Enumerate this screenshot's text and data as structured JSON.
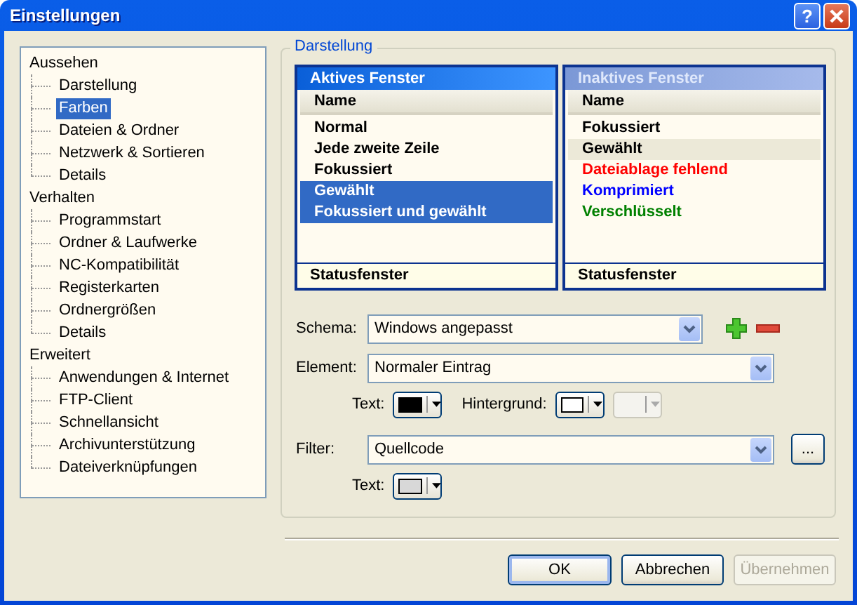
{
  "window": {
    "title": "Einstellungen",
    "help": "?"
  },
  "tree": [
    {
      "label": "Aussehen",
      "selected": false,
      "children": [
        {
          "label": "Darstellung",
          "selected": false
        },
        {
          "label": "Farben",
          "selected": true
        },
        {
          "label": "Dateien & Ordner",
          "selected": false
        },
        {
          "label": "Netzwerk & Sortieren",
          "selected": false
        },
        {
          "label": "Details",
          "selected": false
        }
      ]
    },
    {
      "label": "Verhalten",
      "selected": false,
      "children": [
        {
          "label": "Programmstart",
          "selected": false
        },
        {
          "label": "Ordner & Laufwerke",
          "selected": false
        },
        {
          "label": "NC-Kompatibilität",
          "selected": false
        },
        {
          "label": "Registerkarten",
          "selected": false
        },
        {
          "label": "Ordnergrößen",
          "selected": false
        },
        {
          "label": "Details",
          "selected": false
        }
      ]
    },
    {
      "label": "Erweitert",
      "selected": false,
      "children": [
        {
          "label": "Anwendungen & Internet",
          "selected": false
        },
        {
          "label": "FTP-Client",
          "selected": false
        },
        {
          "label": "Schnellansicht",
          "selected": false
        },
        {
          "label": "Archivunterstützung",
          "selected": false
        },
        {
          "label": "Dateiverknüpfungen",
          "selected": false
        }
      ]
    }
  ],
  "group": {
    "title": "Darstellung",
    "panels": [
      {
        "title": "Aktives Fenster",
        "active": true,
        "column": "Name",
        "status": "Statusfenster",
        "rows": [
          {
            "label": "Normal",
            "selected": false
          },
          {
            "label": "Jede zweite Zeile",
            "selected": false
          },
          {
            "label": "Fokussiert",
            "selected": false
          },
          {
            "label": "Gewählt",
            "selected": true
          },
          {
            "label": "Fokussiert und gewählt",
            "selected": true
          }
        ]
      },
      {
        "title": "Inaktives Fenster",
        "active": false,
        "column": "Name",
        "status": "Statusfenster",
        "rows": [
          {
            "label": "Fokussiert",
            "selected": false,
            "color": "#000000"
          },
          {
            "label": "Gewählt",
            "selected": true,
            "color": "#000000"
          },
          {
            "label": "Dateiablage fehlend",
            "selected": false,
            "color": "#ff0000"
          },
          {
            "label": "Komprimiert",
            "selected": false,
            "color": "#0000ff"
          },
          {
            "label": "Verschlüsselt",
            "selected": false,
            "color": "#008000"
          }
        ]
      }
    ],
    "schema": {
      "label": "Schema:",
      "value": "Windows angepasst"
    },
    "element": {
      "label": "Element:",
      "value": "Normaler Eintrag"
    },
    "element_colors": {
      "text": {
        "label": "Text:",
        "color": "#000000"
      },
      "background_label": "Hintergrund:",
      "pickers": [
        {
          "color": "#ffffff",
          "disabled": false
        },
        {
          "disabled": true
        }
      ]
    },
    "filter": {
      "label": "Filter:",
      "value": "Quellcode",
      "button": "...",
      "text": {
        "label": "Text:",
        "color": "#d8d8d8"
      }
    }
  },
  "buttons": [
    {
      "label": "OK",
      "default": true,
      "disabled": false
    },
    {
      "label": "Abbrechen",
      "default": false,
      "disabled": false
    },
    {
      "label": "Übernehmen",
      "default": false,
      "disabled": true
    }
  ]
}
